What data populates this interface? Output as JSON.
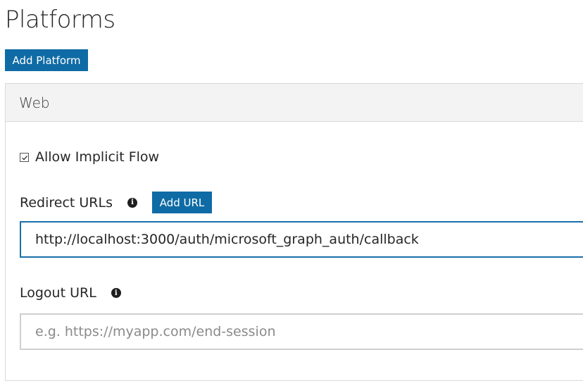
{
  "page": {
    "title": "Platforms",
    "add_platform_label": "Add Platform"
  },
  "panel": {
    "header": "Web",
    "allow_implicit_flow": {
      "label": "Allow Implicit Flow",
      "checked": true
    },
    "redirect": {
      "label": "Redirect URLs",
      "add_url_label": "Add URL",
      "value": "http://localhost:3000/auth/microsoft_graph_auth/callback"
    },
    "logout": {
      "label": "Logout URL",
      "value": "",
      "placeholder": "e.g. https://myapp.com/end-session"
    }
  },
  "icons": {
    "info": "info-icon",
    "check": "checkmark-icon"
  },
  "colors": {
    "button": "#0f6ba5",
    "focus_border": "#1b6fa8",
    "panel_header": "#f3f3f3"
  }
}
